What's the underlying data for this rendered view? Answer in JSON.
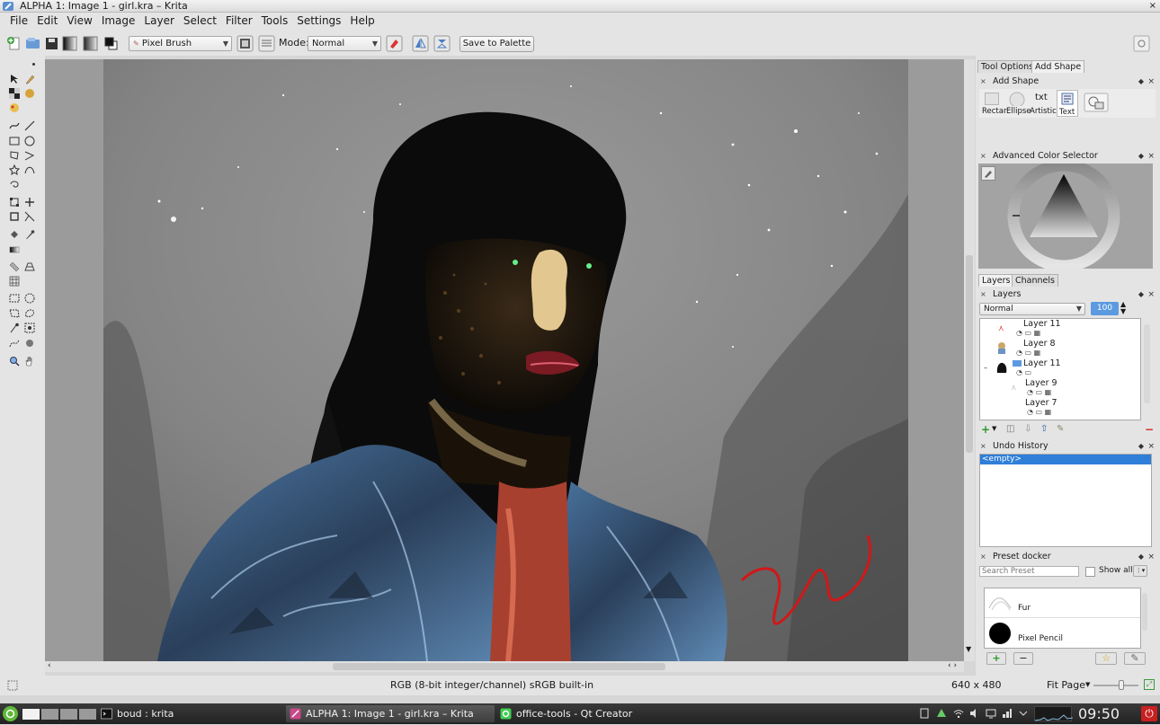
{
  "window": {
    "title": "ALPHA 1: Image 1 - girl.kra – Krita",
    "close_glyph": "×"
  },
  "menu": [
    "File",
    "Edit",
    "View",
    "Image",
    "Layer",
    "Select",
    "Filter",
    "Tools",
    "Settings",
    "Help"
  ],
  "toolbar": {
    "brush_preset": "Pixel Brush",
    "mode_label": "Mode:",
    "mode_value": "Normal",
    "save_palette": "Save to Palette"
  },
  "dock": {
    "tool_tabs": [
      "Tool Options",
      "Add Shape"
    ],
    "add_shape": {
      "title": "Add Shape",
      "shapes": [
        "Rectar",
        "Ellipse",
        "Artistic",
        "Text"
      ]
    },
    "color_selector": {
      "title": "Advanced Color Selector"
    },
    "layer_tabs": [
      "Layers",
      "Channels"
    ],
    "layers": {
      "title": "Layers",
      "blend_mode": "Normal",
      "opacity": "100",
      "items": [
        {
          "name": "Layer 11",
          "indent": true
        },
        {
          "name": "Layer 8",
          "indent": true
        },
        {
          "name": "Layer 11",
          "indent": true,
          "selected_group": true
        },
        {
          "name": "Layer 9",
          "indent": true
        },
        {
          "name": "Layer 7",
          "indent": true
        }
      ]
    },
    "undo": {
      "title": "Undo History",
      "items": [
        "<empty>"
      ]
    },
    "presets": {
      "title": "Preset docker",
      "search_placeholder": "Search Preset",
      "show_all": "Show all",
      "items": [
        "Fur",
        "Pixel Pencil"
      ]
    }
  },
  "statusbar": {
    "color_profile": "RGB (8-bit integer/channel)  sRGB built-in",
    "dimensions": "640 x 480",
    "zoom": "Fit Page"
  },
  "taskbar": {
    "tasks": [
      {
        "label": "boud : krita"
      },
      {
        "label": "ALPHA 1: Image 1 - girl.kra – Krita",
        "active": true
      },
      {
        "label": "office-tools - Qt Creator"
      }
    ],
    "clock": "09:50"
  },
  "colors": {
    "accent": "#2f7fd8",
    "selection": "#4f8ed8",
    "taskbar": "#2a2a2a",
    "signature_red": "#d01818"
  }
}
